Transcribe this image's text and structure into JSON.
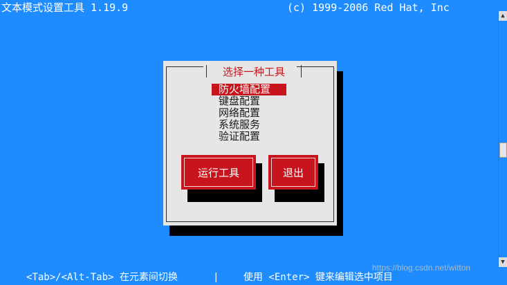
{
  "header": {
    "title": "文本模式设置工具 1.19.9",
    "copyright": "(c) 1999-2006 Red Hat, Inc"
  },
  "dialog": {
    "title": "选择一种工具",
    "items": [
      {
        "label": "防火墙配置",
        "selected": true
      },
      {
        "label": "键盘配置",
        "selected": false
      },
      {
        "label": "网络配置",
        "selected": false
      },
      {
        "label": "系统服务",
        "selected": false
      },
      {
        "label": "验证配置",
        "selected": false
      }
    ],
    "run_button": "运行工具",
    "quit_button": "退出"
  },
  "statusbar": {
    "tab_hint": "<Tab>/<Alt-Tab> 在元素间切换",
    "separator": "|",
    "enter_hint": "使用 <Enter> 键来编辑选中项目"
  },
  "watermark": "https://blog.csdn.net/witton",
  "colors": {
    "background": "#1e8cff",
    "dialog": "#e6e6e6",
    "accent": "#c8141c",
    "shadow": "#000000"
  }
}
